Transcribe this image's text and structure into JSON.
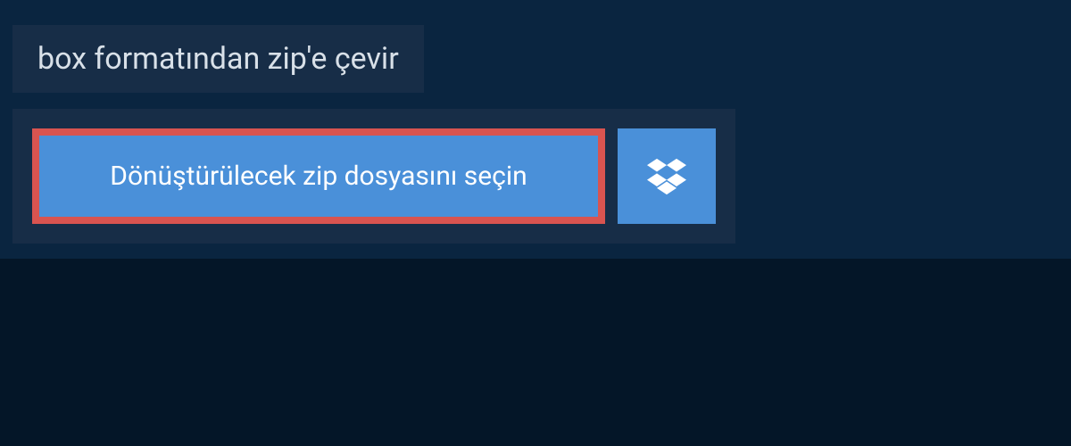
{
  "header": {
    "title": "box formatından zip'e çevir"
  },
  "upload": {
    "select_file_label": "Dönüştürülecek zip dosyasını seçin"
  }
}
